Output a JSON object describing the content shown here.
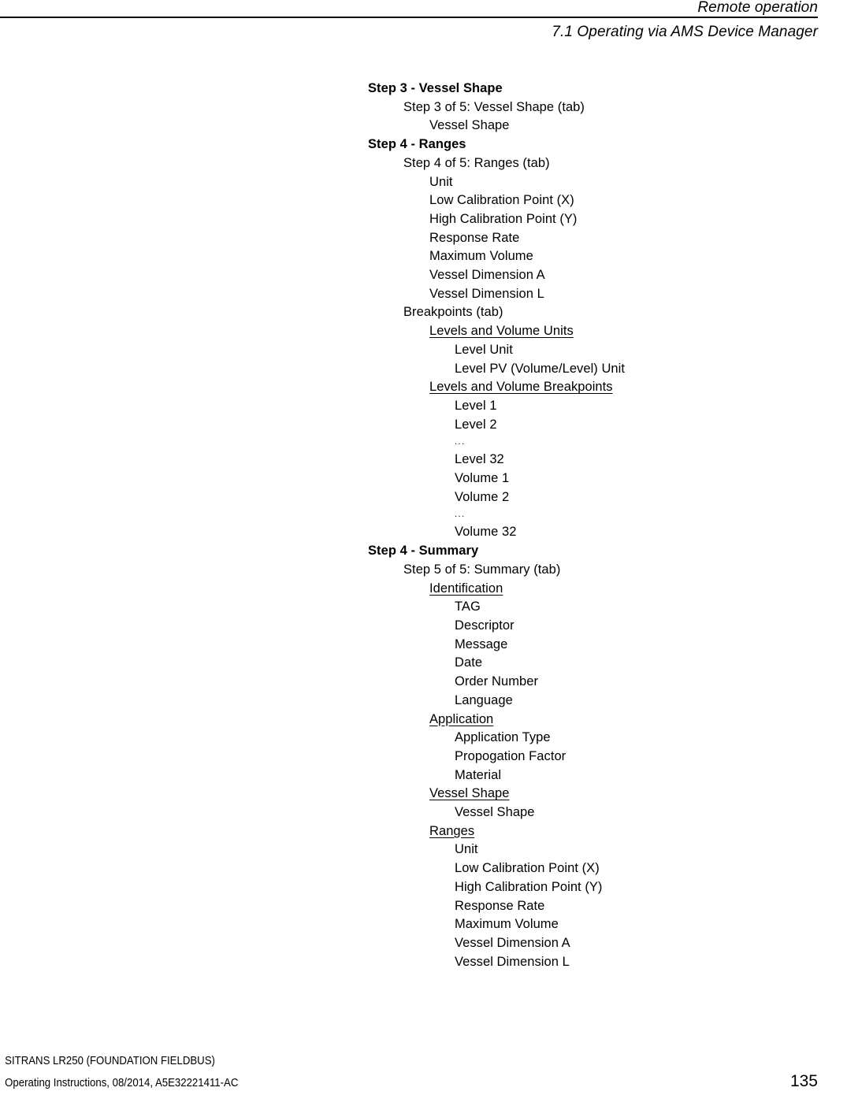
{
  "header": {
    "chapter": "Remote operation",
    "section": "7.1 Operating via AMS Device Manager"
  },
  "outline": [
    {
      "level": "step",
      "text": "Step 3 - Vessel Shape"
    },
    {
      "level": "1",
      "text": "Step 3 of 5: Vessel Shape (tab)"
    },
    {
      "level": "2",
      "text": "Vessel Shape"
    },
    {
      "level": "step",
      "text": "Step 4 - Ranges"
    },
    {
      "level": "1",
      "text": "Step 4 of 5: Ranges (tab)"
    },
    {
      "level": "2",
      "text": "Unit"
    },
    {
      "level": "2",
      "text": "Low Calibration Point (X)"
    },
    {
      "level": "2",
      "text": "High Calibration Point (Y)"
    },
    {
      "level": "2",
      "text": "Response Rate"
    },
    {
      "level": "2",
      "text": "Maximum Volume"
    },
    {
      "level": "2",
      "text": "Vessel Dimension A"
    },
    {
      "level": "2",
      "text": "Vessel Dimension L"
    },
    {
      "level": "1",
      "text": "Breakpoints (tab)"
    },
    {
      "level": "2",
      "text": "Levels and Volume Units",
      "underline": true
    },
    {
      "level": "3",
      "text": "Level Unit"
    },
    {
      "level": "3",
      "text": "Level PV (Volume/Level) Unit"
    },
    {
      "level": "2",
      "text": "Levels and Volume Breakpoints",
      "underline": true
    },
    {
      "level": "3",
      "text": "Level 1"
    },
    {
      "level": "3",
      "text": "Level 2"
    },
    {
      "level": "3",
      "text": "...",
      "ellipsis": true
    },
    {
      "level": "3",
      "text": "Level 32"
    },
    {
      "level": "3",
      "text": "Volume 1"
    },
    {
      "level": "3",
      "text": "Volume 2"
    },
    {
      "level": "3",
      "text": "...",
      "ellipsis": true
    },
    {
      "level": "3",
      "text": "Volume 32"
    },
    {
      "level": "step",
      "text": "Step 4 - Summary"
    },
    {
      "level": "1",
      "text": "Step 5 of 5: Summary (tab)"
    },
    {
      "level": "2",
      "text": "Identification",
      "underline": true
    },
    {
      "level": "3",
      "text": "TAG"
    },
    {
      "level": "3",
      "text": "Descriptor"
    },
    {
      "level": "3",
      "text": "Message"
    },
    {
      "level": "3",
      "text": "Date"
    },
    {
      "level": "3",
      "text": "Order Number"
    },
    {
      "level": "3",
      "text": "Language"
    },
    {
      "level": "2",
      "text": "Application",
      "underline": true
    },
    {
      "level": "3",
      "text": "Application Type"
    },
    {
      "level": "3",
      "text": "Propogation Factor"
    },
    {
      "level": "3",
      "text": "Material"
    },
    {
      "level": "2",
      "text": "Vessel Shape",
      "underline": true
    },
    {
      "level": "3",
      "text": "Vessel Shape"
    },
    {
      "level": "2",
      "text": "Ranges",
      "underline": true
    },
    {
      "level": "3",
      "text": "Unit"
    },
    {
      "level": "3",
      "text": "Low Calibration Point (X)"
    },
    {
      "level": "3",
      "text": "High Calibration Point (Y)"
    },
    {
      "level": "3",
      "text": "Response Rate"
    },
    {
      "level": "3",
      "text": "Maximum Volume"
    },
    {
      "level": "3",
      "text": "Vessel Dimension A"
    },
    {
      "level": "3",
      "text": "Vessel Dimension L"
    }
  ],
  "footer": {
    "product": "SITRANS LR250 (FOUNDATION FIELDBUS)",
    "document": "Operating Instructions, 08/2014, A5E32221411-AC",
    "page_number": "135"
  }
}
